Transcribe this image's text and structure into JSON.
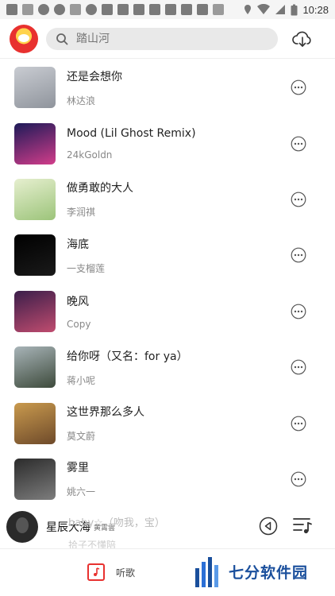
{
  "status_bar": {
    "time": "10:28"
  },
  "header": {
    "search_placeholder": "踏山河"
  },
  "songs": [
    {
      "title": "还是会想你",
      "artist": "林达浪",
      "cover_colors": [
        "#c9ccd2",
        "#8f949c"
      ]
    },
    {
      "title": "Mood (Lil Ghost Remix)",
      "artist": "24kGoldn",
      "cover_colors": [
        "#1d1a58",
        "#d23d8a"
      ]
    },
    {
      "title": "做勇敢的大人",
      "artist": "李润祺",
      "cover_colors": [
        "#e6efcf",
        "#9cc47a"
      ]
    },
    {
      "title": "海底",
      "artist": "一支榴莲",
      "cover_colors": [
        "#000000",
        "#1a1a1a"
      ]
    },
    {
      "title": "晚风",
      "artist": "Copy",
      "cover_colors": [
        "#3b1e4a",
        "#c04c6f"
      ]
    },
    {
      "title": "给你呀（又名：for ya）",
      "artist": "蒋小呢",
      "cover_colors": [
        "#a8b4b8",
        "#3d4a3b"
      ]
    },
    {
      "title": "这世界那么多人",
      "artist": "莫文蔚",
      "cover_colors": [
        "#c99a4e",
        "#6e4a2a"
      ]
    },
    {
      "title": "雾里",
      "artist": "姚六一",
      "cover_colors": [
        "#2b2b2b",
        "#7d7d7d"
      ]
    }
  ],
  "mini_player": {
    "title": "星辰大海",
    "artist": "黄霄雲",
    "ghost_line_1": "baby☆（吻我，宝）",
    "ghost_line_2": "拾子不懂陪"
  },
  "tab_bar": {
    "listen_label": "听歌",
    "watermark": "七分软件园"
  },
  "colors": {
    "accent": "#e8312f",
    "watermark_blue": "#1a4f9c"
  }
}
